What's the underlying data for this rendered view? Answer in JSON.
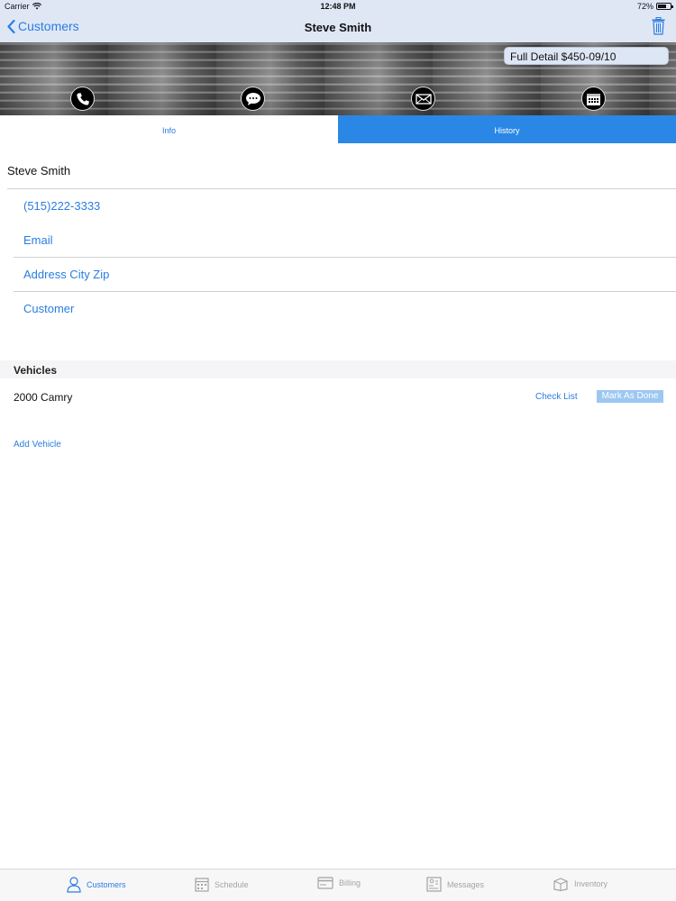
{
  "status_bar": {
    "carrier": "Carrier",
    "time": "12:48 PM",
    "battery": "72%",
    "battery_level": 0.72
  },
  "nav": {
    "back_label": "Customers",
    "title": "Steve Smith"
  },
  "banner": {
    "deal_text": "Full Detail $450-09/10",
    "icons": [
      "phone-icon",
      "message-icon",
      "email-icon",
      "calendar-icon"
    ]
  },
  "tabs": {
    "info": "Info",
    "history": "History",
    "selected": "history"
  },
  "customer": {
    "name": "Steve Smith",
    "phone": "(515)222-3333",
    "email": "Email",
    "address": "Address City Zip",
    "type": "Customer"
  },
  "vehicles": {
    "header": "Vehicles",
    "items": [
      {
        "name": "2000 Camry",
        "checklist": "Check List",
        "mark_done": "Mark As Done"
      }
    ],
    "add_label": "Add Vehicle"
  },
  "tab_bar": {
    "items": [
      {
        "label": "Customers",
        "icon": "person-icon",
        "active": true
      },
      {
        "label": "Schedule",
        "icon": "calendar-icon",
        "active": false
      },
      {
        "label": "Billing",
        "icon": "card-icon",
        "active": false
      },
      {
        "label": "Messages",
        "icon": "messages-icon",
        "active": false
      },
      {
        "label": "Inventory",
        "icon": "box-icon",
        "active": false
      }
    ]
  },
  "colors": {
    "accent": "#2a7de1",
    "nav_bg": "#dfe7f5",
    "selected_tab": "#2a87e6",
    "inactive": "#a3a3a3"
  }
}
